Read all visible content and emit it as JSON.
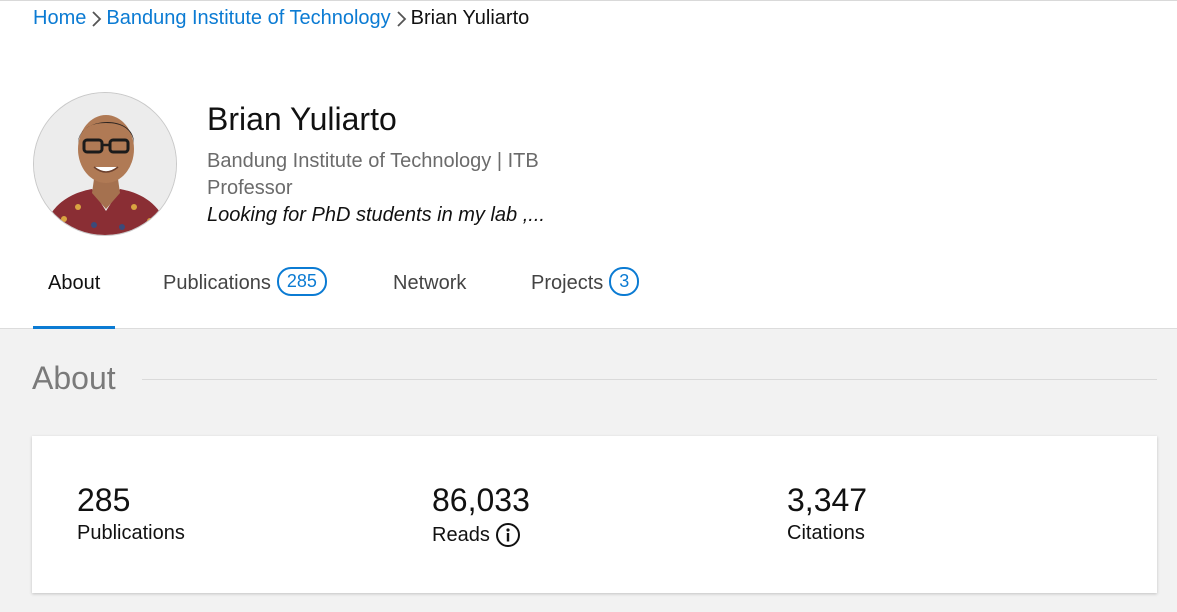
{
  "breadcrumb": {
    "items": [
      "Home",
      "Bandung Institute of Technology"
    ],
    "current": "Brian Yuliarto"
  },
  "profile": {
    "name": "Brian Yuliarto",
    "institution": "Bandung Institute of Technology | ITB",
    "position": "Professor",
    "headline": "Looking for PhD students in my lab ,..."
  },
  "tabs": [
    {
      "label": "About",
      "badge": null
    },
    {
      "label": "Publications",
      "badge": "285"
    },
    {
      "label": "Network",
      "badge": null
    },
    {
      "label": "Projects",
      "badge": "3"
    }
  ],
  "about": {
    "title": "About",
    "stats": [
      {
        "value": "285",
        "label": "Publications"
      },
      {
        "value": "86,033",
        "label": "Reads"
      },
      {
        "value": "3,347",
        "label": "Citations"
      }
    ]
  },
  "colors": {
    "accent": "#0b7bd3"
  },
  "icons": {
    "breadcrumb_separator": "chevron-right-icon",
    "reads_info": "info-icon"
  }
}
